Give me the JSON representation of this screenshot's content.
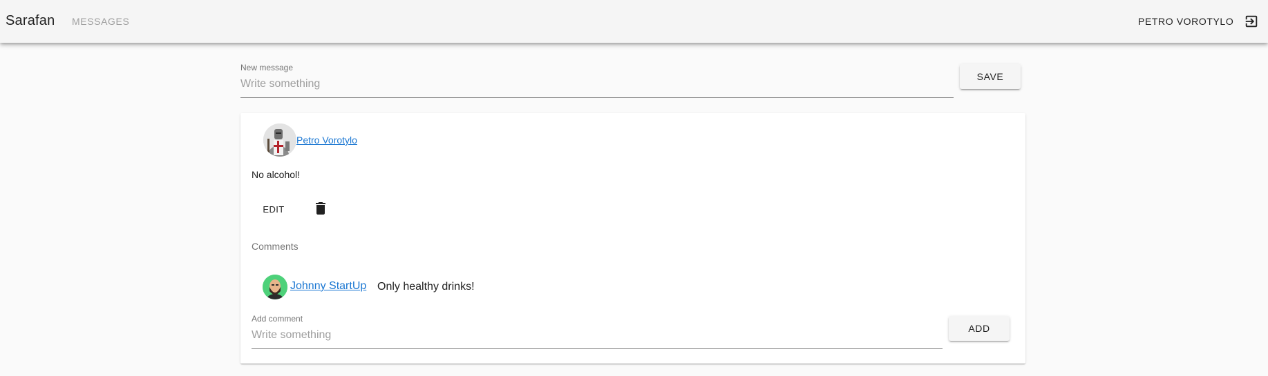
{
  "header": {
    "brand": "Sarafan",
    "nav_messages": "Messages",
    "user_name": "Petro Vorotylo",
    "logout_icon": "logout-icon"
  },
  "new_message": {
    "label": "New message",
    "placeholder": "Write something",
    "value": "",
    "save_label": "Save"
  },
  "message": {
    "author": " Petro Vorotylo",
    "avatar_icon": "knight-avatar",
    "text": "No alcohol!",
    "edit_label": "Edit",
    "delete_icon": "trash-icon",
    "comments_title": "Comments",
    "comments": [
      {
        "author": "Johnny StartUp",
        "avatar_icon": "bearded-man-avatar",
        "text": "Only healthy drinks!"
      }
    ],
    "add_comment": {
      "label": "Add comment",
      "placeholder": "Write something",
      "value": "",
      "add_label": "Add"
    }
  },
  "colors": {
    "toolbar_bg": "#f5f5f5",
    "page_bg": "#fafafa",
    "link": "#1976d2",
    "muted": "#9e9e9e"
  }
}
